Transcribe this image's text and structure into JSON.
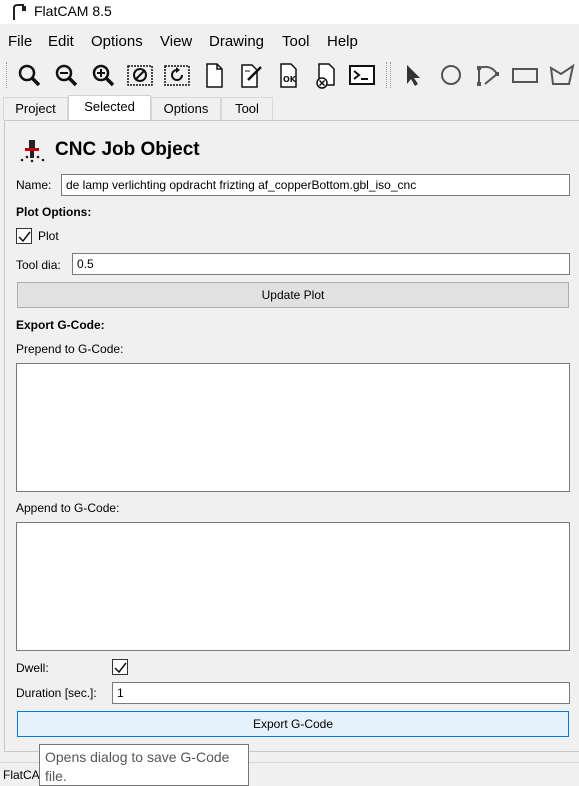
{
  "window": {
    "title": "FlatCAM 8.5"
  },
  "menu": [
    "File",
    "Edit",
    "Options",
    "View",
    "Drawing",
    "Tool",
    "Help"
  ],
  "toolbar": {
    "icons": [
      "zoom-fit-icon",
      "zoom-out-icon",
      "zoom-in-icon",
      "clear-plot-icon",
      "replot-icon",
      "new-project-icon",
      "edit-icon",
      "ok-icon",
      "delete-icon",
      "shell-icon",
      "select-icon",
      "circle-icon",
      "arc-icon",
      "rectangle-icon",
      "polygon-icon"
    ]
  },
  "tabs": [
    {
      "label": "Project",
      "active": false
    },
    {
      "label": "Selected",
      "active": true
    },
    {
      "label": "Options",
      "active": false
    },
    {
      "label": "Tool",
      "active": false
    }
  ],
  "panel": {
    "heading": "CNC Job Object",
    "name_label": "Name:",
    "name_value": "de lamp verlichting opdracht frizting af_copperBottom.gbl_iso_cnc",
    "plot_options_label": "Plot Options:",
    "plot_checkbox_label": "Plot",
    "plot_checked": true,
    "tool_dia_label": "Tool dia:",
    "tool_dia_value": "0.5",
    "update_plot_label": "Update Plot",
    "export_section_label": "Export G-Code:",
    "prepend_label": "Prepend to G-Code:",
    "prepend_value": "",
    "append_label": "Append to G-Code:",
    "append_value": "",
    "dwell_label": "Dwell:",
    "dwell_checked": true,
    "duration_label": "Duration [sec.]:",
    "duration_value": "1",
    "export_button_label": "Export G-Code"
  },
  "status": {
    "text": "FlatCAM"
  },
  "tooltip": {
    "text": "Opens dialog to save G-Code file."
  }
}
